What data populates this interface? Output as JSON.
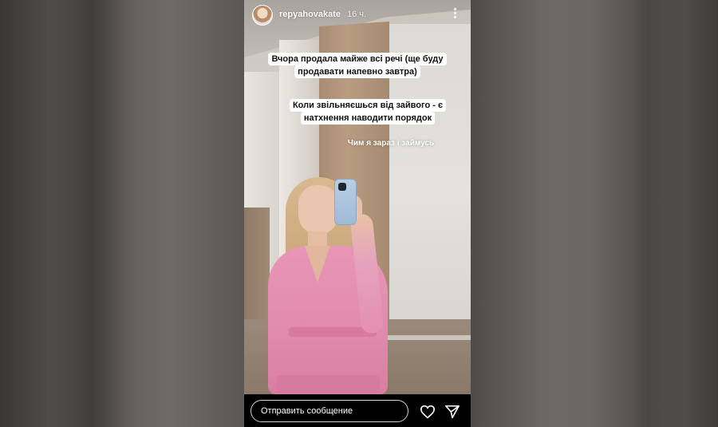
{
  "story": {
    "username": "repyahovakate",
    "time_ago": "16 ч.",
    "caption_1_lines": [
      "Вчора продала майже всі речі (ще буду",
      "продавати напевно завтра)"
    ],
    "caption_2_lines": [
      "Коли звільняєшься від зайвого - є",
      "натхнення наводити порядок"
    ],
    "caption_3": "Чим я зараз і займусь"
  },
  "reply_bar": {
    "placeholder": "Отправить сообщение"
  },
  "icons": [
    "avatar",
    "more-vertical-icon",
    "heart-icon",
    "send-icon"
  ]
}
